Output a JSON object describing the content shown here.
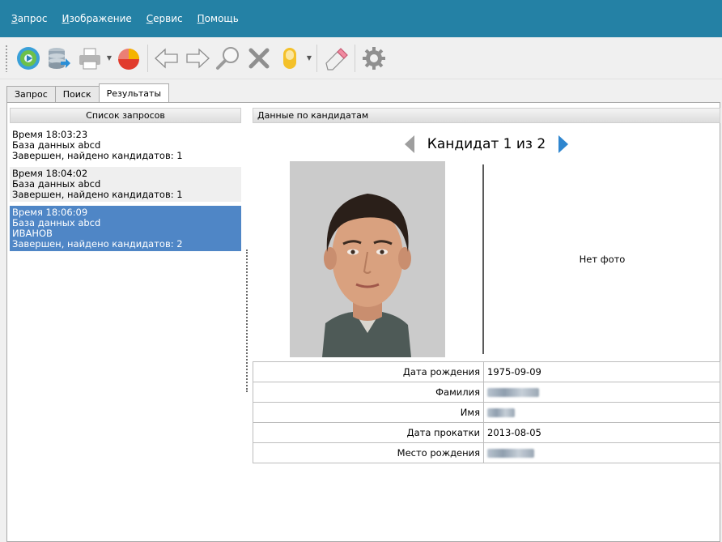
{
  "menu": [
    {
      "accel": "З",
      "rest": "апрос"
    },
    {
      "accel": "И",
      "rest": "зображение"
    },
    {
      "accel": "С",
      "rest": "ервис"
    },
    {
      "accel": "П",
      "rest": "омощь"
    }
  ],
  "toolbar": {
    "icons": [
      "scan-disc-icon",
      "database-export-icon",
      "print-icon",
      "pie-chart-icon",
      "arrow-left-icon",
      "arrow-right-icon",
      "zoom-icon",
      "delete-icon",
      "finger-icon",
      "eraser-icon",
      "gear-icon"
    ]
  },
  "tabs": [
    "Запрос",
    "Поиск",
    "Результаты"
  ],
  "active_tab": "Результаты",
  "left_panel": {
    "header": "Список запросов",
    "requests": [
      {
        "lines": [
          "Время 18:03:23",
          "База данных abcd",
          "Завершен, найдено кандидатов: 1"
        ]
      },
      {
        "lines": [
          "Время 18:04:02",
          "База данных abcd",
          "Завершен, найдено кандидатов: 1"
        ]
      },
      {
        "lines": [
          "Время 18:06:09",
          "База данных abcd",
          "ИВАНОВ",
          "Завершен, найдено кандидатов: 2"
        ]
      }
    ]
  },
  "right_panel": {
    "header": "Данные по кандидатам",
    "candidate_title": "Кандидат 1 из 2",
    "no_photo": "Нет фото",
    "fields": [
      {
        "key": "Дата рождения",
        "value": "1975-09-09"
      },
      {
        "key": "Фамилия",
        "value": ""
      },
      {
        "key": "Имя",
        "value": ""
      },
      {
        "key": "Дата прокатки",
        "value": "2013-08-05"
      },
      {
        "key": "Место рождения",
        "value": ""
      }
    ]
  },
  "colors": {
    "menubar": "#2481a5",
    "selection": "#4f86c6",
    "nav_arrow_prev": "#9e9e9e",
    "nav_arrow_next": "#2f86cf"
  }
}
